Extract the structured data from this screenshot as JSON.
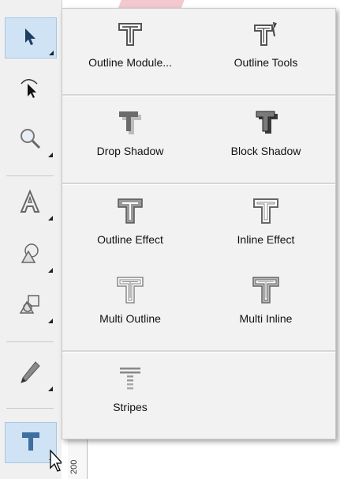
{
  "flyout": {
    "groups": [
      {
        "items": [
          {
            "label": "Outline Module...",
            "icon": "outline-module-icon"
          },
          {
            "label": "Outline Tools",
            "icon": "outline-tools-icon"
          }
        ]
      },
      {
        "items": [
          {
            "label": "Drop Shadow",
            "icon": "drop-shadow-icon"
          },
          {
            "label": "Block Shadow",
            "icon": "block-shadow-icon"
          }
        ]
      },
      {
        "items": [
          {
            "label": "Outline Effect",
            "icon": "outline-effect-icon"
          },
          {
            "label": "Inline Effect",
            "icon": "inline-effect-icon"
          },
          {
            "label": "Multi Outline",
            "icon": "multi-outline-icon"
          },
          {
            "label": "Multi Inline",
            "icon": "multi-inline-icon"
          }
        ]
      },
      {
        "items": [
          {
            "label": "Stripes",
            "icon": "stripes-icon"
          }
        ]
      }
    ]
  },
  "toolbar": {
    "tools": [
      {
        "name": "select-tool",
        "icon": "arrow-pointer-icon",
        "active": true
      },
      {
        "name": "node-edit-tool",
        "icon": "node-edit-icon"
      },
      {
        "name": "zoom-tool",
        "icon": "magnifier-icon"
      },
      {
        "name": "text-tool",
        "icon": "outline-a-icon"
      },
      {
        "name": "shape-tool",
        "icon": "shapes-icon"
      },
      {
        "name": "shape-edit-tool",
        "icon": "shapes-edit-icon"
      },
      {
        "name": "pen-tool",
        "icon": "pencil-icon"
      },
      {
        "name": "text-effects-tool",
        "icon": "text-effects-t-icon",
        "active": true
      }
    ]
  },
  "ruler": {
    "label": "200"
  },
  "colors": {
    "active_bg": "#cfe3f5",
    "accent_blue": "#3d6f9f",
    "panel_bg": "#f2f2f2"
  }
}
